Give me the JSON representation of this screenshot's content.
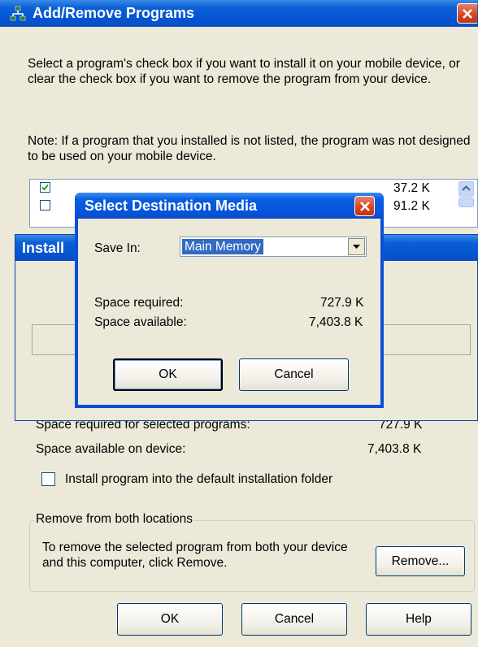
{
  "main_window": {
    "title": "Add/Remove Programs",
    "intro": "Select a program's check box if you want to install it on your mobile device, or clear the check box if you want to remove the program from your device.",
    "note": "Note:  If a program that you installed is not listed, the program was not designed to be used on your mobile device.",
    "programs": [
      {
        "size": "37.2 K",
        "checked": true
      },
      {
        "size": "91.2 K",
        "checked": false
      }
    ],
    "space_required_label": "Space required for selected programs:",
    "space_required_value": "727.9 K",
    "space_available_label": "Space available on device:",
    "space_available_value": "7,403.8 K",
    "default_folder_label": "Install program into the default installation folder",
    "remove_group_label": "Remove from both locations",
    "remove_text": "To remove the selected program from both your device and this computer, click Remove.",
    "remove_button": "Remove...",
    "ok_button": "OK",
    "cancel_button": "Cancel",
    "help_button": "Help"
  },
  "install_window": {
    "title": "Install"
  },
  "dialog": {
    "title": "Select Destination Media",
    "save_in_label": "Save In:",
    "save_in_value": "Main Memory",
    "space_required_label": "Space required:",
    "space_required_value": "727.9 K",
    "space_available_label": "Space available:",
    "space_available_value": "7,403.8 K",
    "ok_button": "OK",
    "cancel_button": "Cancel"
  },
  "colors": {
    "title_bar": "#0554d1",
    "close_red": "#d3441f",
    "window_bg": "#ece9d8"
  }
}
